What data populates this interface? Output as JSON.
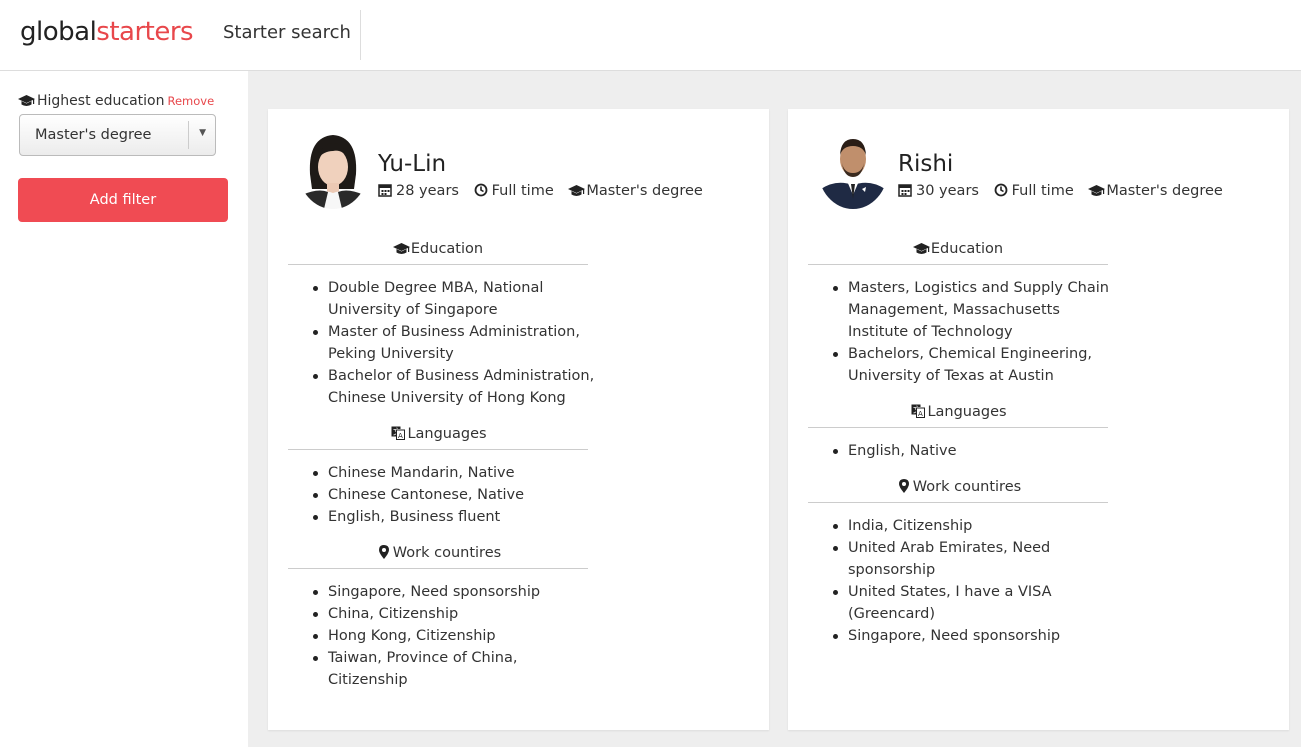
{
  "header": {
    "logo_part1": "global",
    "logo_part2": "starters",
    "nav_link": "Starter search",
    "brand_color": "#e8474b"
  },
  "sidebar": {
    "filter_label": "Highest education",
    "filter_icon": "graduation-cap-icon",
    "remove_label": "Remove",
    "select_value": "Master's degree",
    "add_filter_label": "Add filter"
  },
  "cards": [
    {
      "name": "Yu-Lin",
      "age": "28 years",
      "employment": "Full time",
      "degree": "Master's degree",
      "education_title": "Education",
      "education": [
        "Double Degree MBA, National University of Singapore",
        "Master of Business Administration, Peking University",
        "Bachelor of Business Administration, Chinese University of Hong Kong"
      ],
      "languages_title": "Languages",
      "languages": [
        "Chinese Mandarin, Native",
        "Chinese Cantonese, Native",
        "English, Business fluent"
      ],
      "countries_title": "Work countires",
      "countries": [
        "Singapore, Need sponsorship",
        "China, Citizenship",
        "Hong Kong, Citizenship",
        "Taiwan, Province of China, Citizenship"
      ]
    },
    {
      "name": "Rishi",
      "age": "30 years",
      "employment": "Full time",
      "degree": "Master's degree",
      "education_title": "Education",
      "education": [
        "Masters, Logistics and Supply Chain Management, Massachusetts Institute of Technology",
        "Bachelors, Chemical Engineering, University of Texas at Austin"
      ],
      "languages_title": "Languages",
      "languages": [
        "English, Native"
      ],
      "countries_title": "Work countires",
      "countries": [
        "India, Citizenship",
        "United Arab Emirates, Need sponsorship",
        "United States, I have a VISA (Greencard)",
        "Singapore, Need sponsorship"
      ]
    }
  ]
}
